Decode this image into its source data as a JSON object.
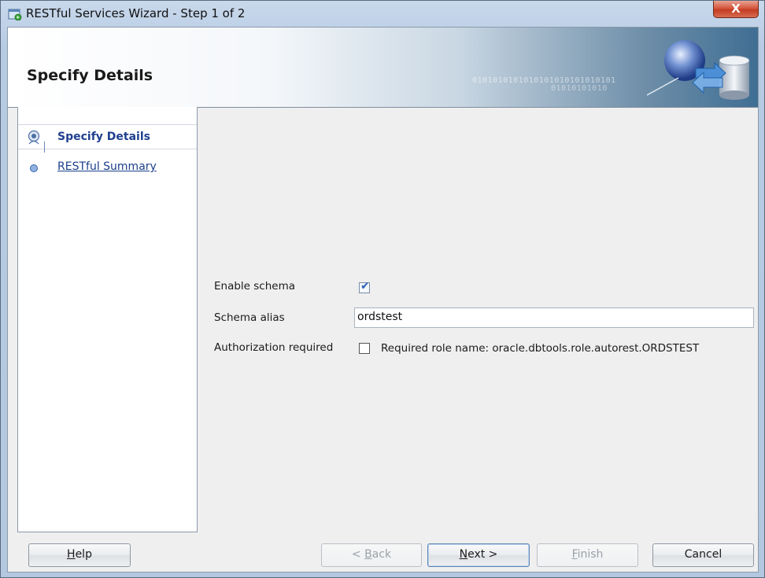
{
  "window": {
    "title": "RESTful Services Wizard - Step 1 of 2",
    "close_glyph": "X"
  },
  "banner": {
    "title": "Specify Details",
    "binary_line1": "0101010101010101010101010101",
    "binary_line2": "01010101010"
  },
  "steps": [
    {
      "label": "Specify Details",
      "state": "current",
      "icon": "current-step-icon"
    },
    {
      "label": "RESTful Summary",
      "state": "pending",
      "icon": "pending-step-icon"
    }
  ],
  "form": {
    "enable_schema": {
      "label": "Enable schema",
      "checked": true
    },
    "schema_alias": {
      "label": "Schema alias",
      "value": "ordstest"
    },
    "authorization": {
      "label": "Authorization required",
      "checked": false,
      "role_text": "Required role name: oracle.dbtools.role.autorest.ORDSTEST"
    }
  },
  "buttons": {
    "help": {
      "prefix": "",
      "mnemonic": "H",
      "rest": "elp",
      "enabled": true
    },
    "back": {
      "prefix": "< ",
      "mnemonic": "B",
      "rest": "ack",
      "enabled": false
    },
    "next": {
      "prefix": "",
      "mnemonic": "N",
      "rest": "ext >",
      "enabled": true
    },
    "finish": {
      "prefix": "",
      "mnemonic": "F",
      "rest": "inish",
      "enabled": false
    },
    "cancel": {
      "prefix": "",
      "mnemonic": "",
      "rest": "Cancel",
      "enabled": true
    }
  },
  "colors": {
    "link": "#1c3f8c",
    "close_button": "#c33c22",
    "checkmark": "#2a62b8"
  }
}
